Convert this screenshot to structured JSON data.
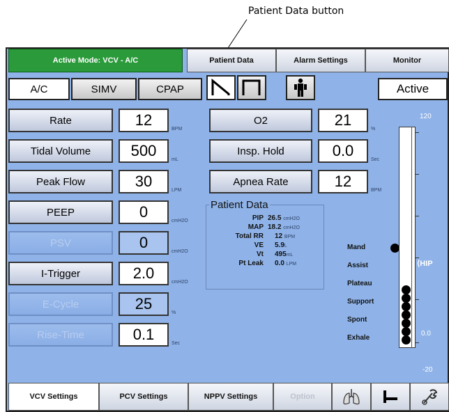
{
  "callout": {
    "text": "Patient Data button"
  },
  "top_bar": {
    "active_mode": "Active Mode:  VCV - A/C",
    "patient_data": "Patient Data",
    "alarm_settings": "Alarm Settings",
    "monitor": "Monitor"
  },
  "modes": {
    "ac": "A/C",
    "simv": "SIMV",
    "cpap": "CPAP",
    "status": "Active"
  },
  "params_left": [
    {
      "label": "Rate",
      "value": "12",
      "unit": "BPM"
    },
    {
      "label": "Tidal Volume",
      "value": "500",
      "unit": "mL"
    },
    {
      "label": "Peak Flow",
      "value": "30",
      "unit": "LPM"
    },
    {
      "label": "PEEP",
      "value": "0",
      "unit": "cmH2O"
    },
    {
      "label": "PSV",
      "value": "0",
      "unit": "cmH2O"
    },
    {
      "label": "I-Trigger",
      "value": "2.0",
      "unit": "cmH2O"
    },
    {
      "label": "E-Cycle",
      "value": "25",
      "unit": "%"
    },
    {
      "label": "Rise-Time",
      "value": "0.1",
      "unit": "Sec"
    }
  ],
  "params_right": [
    {
      "label": "O2",
      "value": "21",
      "unit": "%"
    },
    {
      "label": "Insp. Hold",
      "value": "0.0",
      "unit": "Sec"
    },
    {
      "label": "Apnea Rate",
      "value": "12",
      "unit": "BPM"
    }
  ],
  "patient_data": {
    "title": "Patient Data",
    "rows": [
      {
        "label": "PIP",
        "value": "26.5",
        "unit": "cmH2O"
      },
      {
        "label": "MAP",
        "value": "18.2",
        "unit": "cmH2O"
      },
      {
        "label": "Total RR",
        "value": "12",
        "unit": "BPM"
      },
      {
        "label": "VE",
        "value": "5.9",
        "unit": "L"
      },
      {
        "label": "Vt",
        "value": "495",
        "unit": "mL"
      },
      {
        "label": "Pt Leak",
        "value": "0.0",
        "unit": "LPM"
      }
    ]
  },
  "breath_indicators": [
    "Mand",
    "Assist",
    "Plateau",
    "Support",
    "Spont",
    "Exhale"
  ],
  "pressure_bar": {
    "max": "120",
    "marker": "HIP",
    "zero": "0.0",
    "min": "-20"
  },
  "tabs": {
    "vcv": "VCV Settings",
    "pcv": "PCV Settings",
    "nppv": "NPPV Settings",
    "option": "Option"
  },
  "colors": {
    "screen_bg": "#8fb3e8",
    "active_mode_bg": "#2a9a3a",
    "disabled_text": "#b9cdf0"
  }
}
